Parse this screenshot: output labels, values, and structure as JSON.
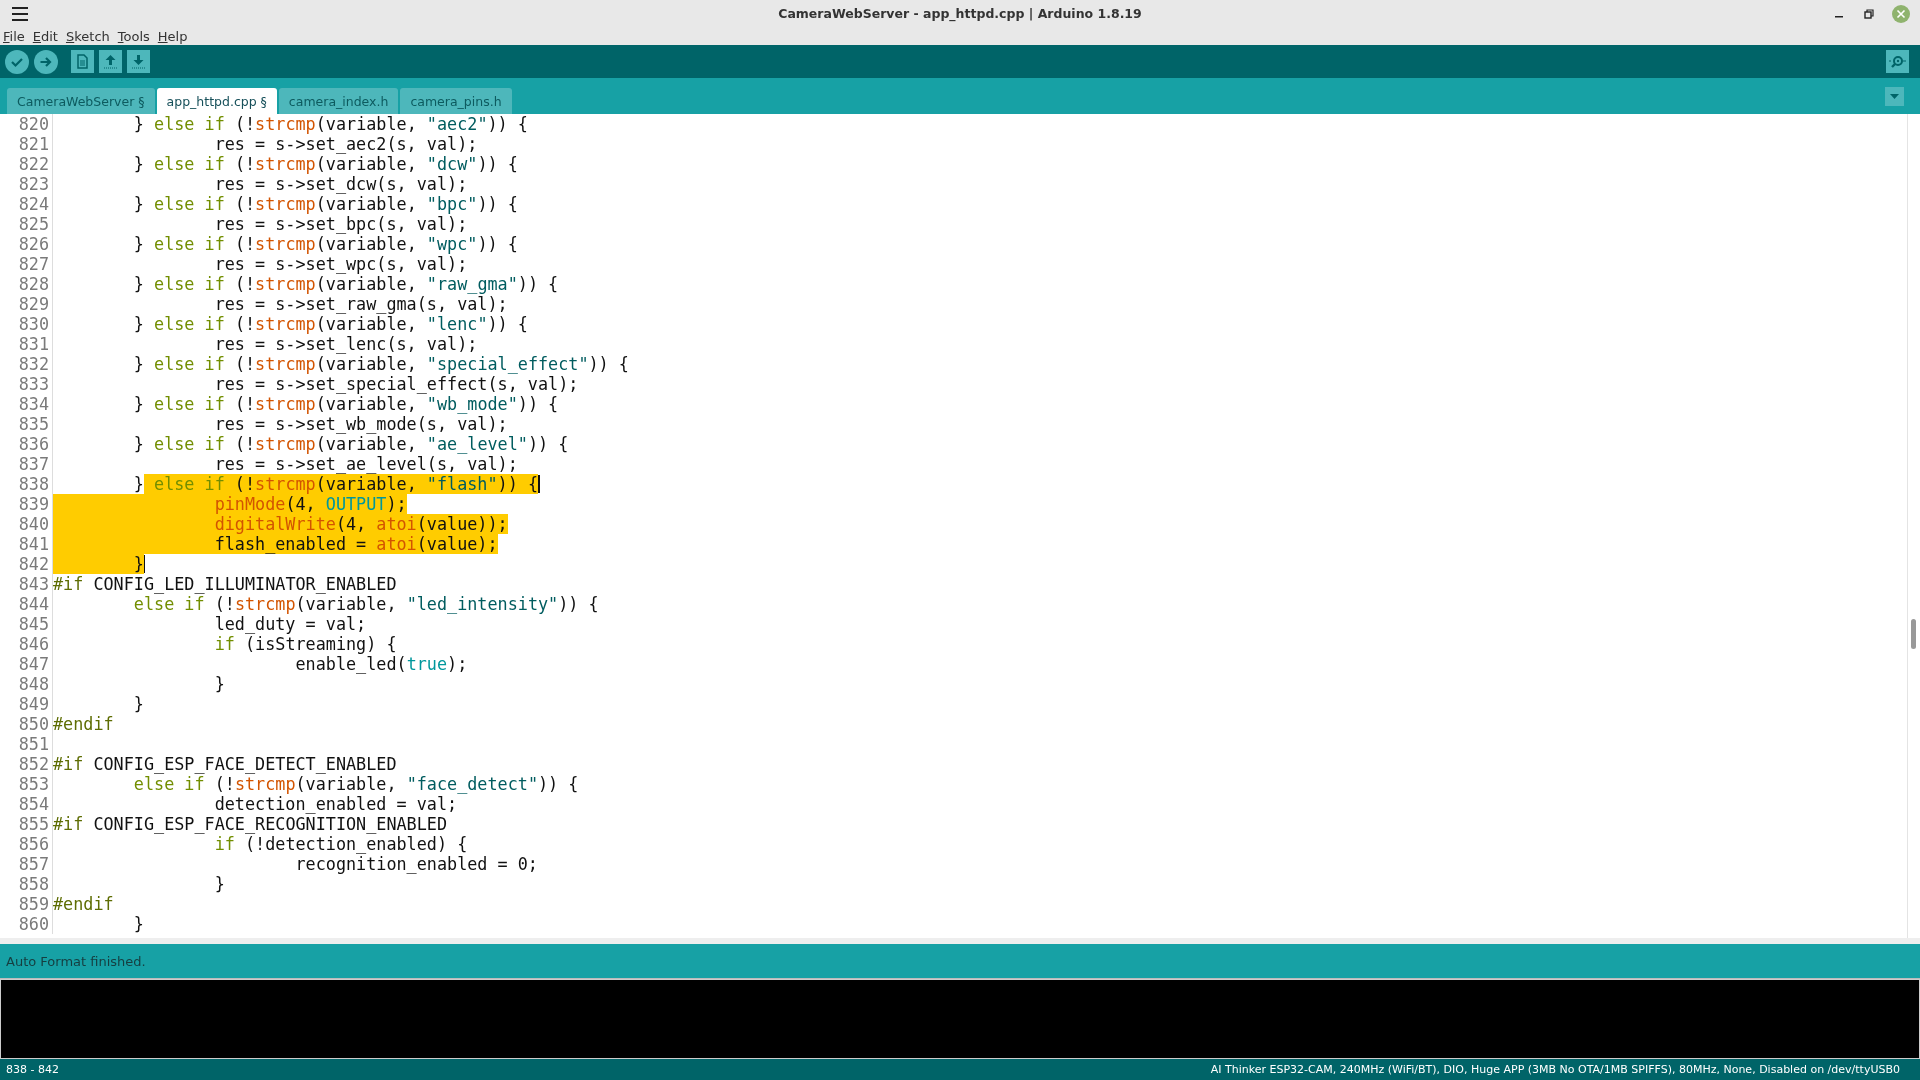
{
  "window": {
    "title": "CameraWebServer - app_httpd.cpp | Arduino 1.8.19"
  },
  "menu": [
    "File",
    "Edit",
    "Sketch",
    "Tools",
    "Help"
  ],
  "tabs": [
    {
      "label": "CameraWebServer §",
      "selected": false
    },
    {
      "label": "app_httpd.cpp §",
      "selected": true
    },
    {
      "label": "camera_index.h",
      "selected": false
    },
    {
      "label": "camera_pins.h",
      "selected": false
    }
  ],
  "editor": {
    "lines": [
      {
        "number": "820",
        "cursor": false,
        "tokens": [
          {
            "kind": "plain",
            "text": "        } "
          },
          {
            "kind": "keyword",
            "text": "else if"
          },
          {
            "kind": "plain",
            "text": " (!"
          },
          {
            "kind": "function",
            "text": "strcmp"
          },
          {
            "kind": "plain",
            "text": "(variable, "
          },
          {
            "kind": "string",
            "text": "\"aec2\""
          },
          {
            "kind": "plain",
            "text": ")) {"
          }
        ]
      },
      {
        "number": "821",
        "cursor": false,
        "tokens": [
          {
            "kind": "plain",
            "text": "                res = s->set_aec2(s, val);"
          }
        ]
      },
      {
        "number": "822",
        "cursor": false,
        "tokens": [
          {
            "kind": "plain",
            "text": "        } "
          },
          {
            "kind": "keyword",
            "text": "else if"
          },
          {
            "kind": "plain",
            "text": " (!"
          },
          {
            "kind": "function",
            "text": "strcmp"
          },
          {
            "kind": "plain",
            "text": "(variable, "
          },
          {
            "kind": "string",
            "text": "\"dcw\""
          },
          {
            "kind": "plain",
            "text": ")) {"
          }
        ]
      },
      {
        "number": "823",
        "cursor": false,
        "tokens": [
          {
            "kind": "plain",
            "text": "                res = s->set_dcw(s, val);"
          }
        ]
      },
      {
        "number": "824",
        "cursor": false,
        "tokens": [
          {
            "kind": "plain",
            "text": "        } "
          },
          {
            "kind": "keyword",
            "text": "else if"
          },
          {
            "kind": "plain",
            "text": " (!"
          },
          {
            "kind": "function",
            "text": "strcmp"
          },
          {
            "kind": "plain",
            "text": "(variable, "
          },
          {
            "kind": "string",
            "text": "\"bpc\""
          },
          {
            "kind": "plain",
            "text": ")) {"
          }
        ]
      },
      {
        "number": "825",
        "cursor": false,
        "tokens": [
          {
            "kind": "plain",
            "text": "                res = s->set_bpc(s, val);"
          }
        ]
      },
      {
        "number": "826",
        "cursor": false,
        "tokens": [
          {
            "kind": "plain",
            "text": "        } "
          },
          {
            "kind": "keyword",
            "text": "else if"
          },
          {
            "kind": "plain",
            "text": " (!"
          },
          {
            "kind": "function",
            "text": "strcmp"
          },
          {
            "kind": "plain",
            "text": "(variable, "
          },
          {
            "kind": "string",
            "text": "\"wpc\""
          },
          {
            "kind": "plain",
            "text": ")) {"
          }
        ]
      },
      {
        "number": "827",
        "cursor": false,
        "tokens": [
          {
            "kind": "plain",
            "text": "                res = s->set_wpc(s, val);"
          }
        ]
      },
      {
        "number": "828",
        "cursor": false,
        "tokens": [
          {
            "kind": "plain",
            "text": "        } "
          },
          {
            "kind": "keyword",
            "text": "else if"
          },
          {
            "kind": "plain",
            "text": " (!"
          },
          {
            "kind": "function",
            "text": "strcmp"
          },
          {
            "kind": "plain",
            "text": "(variable, "
          },
          {
            "kind": "string",
            "text": "\"raw_gma\""
          },
          {
            "kind": "plain",
            "text": ")) {"
          }
        ]
      },
      {
        "number": "829",
        "cursor": false,
        "tokens": [
          {
            "kind": "plain",
            "text": "                res = s->set_raw_gma(s, val);"
          }
        ]
      },
      {
        "number": "830",
        "cursor": false,
        "tokens": [
          {
            "kind": "plain",
            "text": "        } "
          },
          {
            "kind": "keyword",
            "text": "else if"
          },
          {
            "kind": "plain",
            "text": " (!"
          },
          {
            "kind": "function",
            "text": "strcmp"
          },
          {
            "kind": "plain",
            "text": "(variable, "
          },
          {
            "kind": "string",
            "text": "\"lenc\""
          },
          {
            "kind": "plain",
            "text": ")) {"
          }
        ]
      },
      {
        "number": "831",
        "cursor": false,
        "tokens": [
          {
            "kind": "plain",
            "text": "                res = s->set_lenc(s, val);"
          }
        ]
      },
      {
        "number": "832",
        "cursor": false,
        "tokens": [
          {
            "kind": "plain",
            "text": "        } "
          },
          {
            "kind": "keyword",
            "text": "else if"
          },
          {
            "kind": "plain",
            "text": " (!"
          },
          {
            "kind": "function",
            "text": "strcmp"
          },
          {
            "kind": "plain",
            "text": "(variable, "
          },
          {
            "kind": "string",
            "text": "\"special_effect\""
          },
          {
            "kind": "plain",
            "text": ")) {"
          }
        ]
      },
      {
        "number": "833",
        "cursor": false,
        "tokens": [
          {
            "kind": "plain",
            "text": "                res = s->set_special_effect(s, val);"
          }
        ]
      },
      {
        "number": "834",
        "cursor": false,
        "tokens": [
          {
            "kind": "plain",
            "text": "        } "
          },
          {
            "kind": "keyword",
            "text": "else if"
          },
          {
            "kind": "plain",
            "text": " (!"
          },
          {
            "kind": "function",
            "text": "strcmp"
          },
          {
            "kind": "plain",
            "text": "(variable, "
          },
          {
            "kind": "string",
            "text": "\"wb_mode\""
          },
          {
            "kind": "plain",
            "text": ")) {"
          }
        ]
      },
      {
        "number": "835",
        "cursor": false,
        "tokens": [
          {
            "kind": "plain",
            "text": "                res = s->set_wb_mode(s, val);"
          }
        ]
      },
      {
        "number": "836",
        "cursor": false,
        "tokens": [
          {
            "kind": "plain",
            "text": "        } "
          },
          {
            "kind": "keyword",
            "text": "else if"
          },
          {
            "kind": "plain",
            "text": " (!"
          },
          {
            "kind": "function",
            "text": "strcmp"
          },
          {
            "kind": "plain",
            "text": "(variable, "
          },
          {
            "kind": "string",
            "text": "\"ae_level\""
          },
          {
            "kind": "plain",
            "text": ")) {"
          }
        ]
      },
      {
        "number": "837",
        "cursor": false,
        "tokens": [
          {
            "kind": "plain",
            "text": "                res = s->set_ae_level(s, val);"
          }
        ]
      },
      {
        "number": "838",
        "cursor": true,
        "tokens": [
          {
            "kind": "plain",
            "text": "        }"
          }
        ],
        "selected_tokens": [
          {
            "kind": "keyword",
            "text": " else if"
          },
          {
            "kind": "plain",
            "text": " (!"
          },
          {
            "kind": "function",
            "text": "strcmp"
          },
          {
            "kind": "plain",
            "text": "(variable, "
          },
          {
            "kind": "string",
            "text": "\"flash\""
          },
          {
            "kind": "plain",
            "text": ")) {"
          }
        ]
      },
      {
        "number": "839",
        "cursor": false,
        "selected_tokens": [
          {
            "kind": "function",
            "text": "                pinMode"
          },
          {
            "kind": "plain",
            "text": "(4, "
          },
          {
            "kind": "constant",
            "text": "OUTPUT"
          },
          {
            "kind": "plain",
            "text": ");"
          }
        ]
      },
      {
        "number": "840",
        "cursor": false,
        "selected_tokens": [
          {
            "kind": "function",
            "text": "                digitalWrite"
          },
          {
            "kind": "plain",
            "text": "(4, "
          },
          {
            "kind": "function",
            "text": "atoi"
          },
          {
            "kind": "plain",
            "text": "(value));"
          }
        ]
      },
      {
        "number": "841",
        "cursor": false,
        "selected_tokens": [
          {
            "kind": "plain",
            "text": "                flash_enabled = "
          },
          {
            "kind": "function",
            "text": "atoi"
          },
          {
            "kind": "plain",
            "text": "(value);"
          }
        ]
      },
      {
        "number": "842",
        "cursor": true,
        "selected_tokens": [
          {
            "kind": "plain",
            "text": "        }"
          }
        ]
      },
      {
        "number": "843",
        "cursor": false,
        "tokens": [
          {
            "kind": "preprocessor",
            "text": "#if"
          },
          {
            "kind": "plain",
            "text": " CONFIG_LED_ILLUMINATOR_ENABLED"
          }
        ]
      },
      {
        "number": "844",
        "cursor": false,
        "tokens": [
          {
            "kind": "keyword",
            "text": "        else if"
          },
          {
            "kind": "plain",
            "text": " (!"
          },
          {
            "kind": "function",
            "text": "strcmp"
          },
          {
            "kind": "plain",
            "text": "(variable, "
          },
          {
            "kind": "string",
            "text": "\"led_intensity\""
          },
          {
            "kind": "plain",
            "text": ")) {"
          }
        ]
      },
      {
        "number": "845",
        "cursor": false,
        "tokens": [
          {
            "kind": "plain",
            "text": "                led_duty = val;"
          }
        ]
      },
      {
        "number": "846",
        "cursor": false,
        "tokens": [
          {
            "kind": "keyword",
            "text": "                if"
          },
          {
            "kind": "plain",
            "text": " (isStreaming) {"
          }
        ]
      },
      {
        "number": "847",
        "cursor": false,
        "tokens": [
          {
            "kind": "plain",
            "text": "                        enable_led("
          },
          {
            "kind": "constant",
            "text": "true"
          },
          {
            "kind": "plain",
            "text": ");"
          }
        ]
      },
      {
        "number": "848",
        "cursor": false,
        "tokens": [
          {
            "kind": "plain",
            "text": "                }"
          }
        ]
      },
      {
        "number": "849",
        "cursor": false,
        "tokens": [
          {
            "kind": "plain",
            "text": "        }"
          }
        ]
      },
      {
        "number": "850",
        "cursor": false,
        "tokens": [
          {
            "kind": "preprocessor",
            "text": "#endif"
          }
        ]
      },
      {
        "number": "851",
        "cursor": false
      },
      {
        "number": "852",
        "cursor": false,
        "tokens": [
          {
            "kind": "preprocessor",
            "text": "#if"
          },
          {
            "kind": "plain",
            "text": " CONFIG_ESP_FACE_DETECT_ENABLED"
          }
        ]
      },
      {
        "number": "853",
        "cursor": false,
        "tokens": [
          {
            "kind": "keyword",
            "text": "        else if"
          },
          {
            "kind": "plain",
            "text": " (!"
          },
          {
            "kind": "function",
            "text": "strcmp"
          },
          {
            "kind": "plain",
            "text": "(variable, "
          },
          {
            "kind": "string",
            "text": "\"face_detect\""
          },
          {
            "kind": "plain",
            "text": ")) {"
          }
        ]
      },
      {
        "number": "854",
        "cursor": false,
        "tokens": [
          {
            "kind": "plain",
            "text": "                detection_enabled = val;"
          }
        ]
      },
      {
        "number": "855",
        "cursor": false,
        "tokens": [
          {
            "kind": "preprocessor",
            "text": "#if"
          },
          {
            "kind": "plain",
            "text": " CONFIG_ESP_FACE_RECOGNITION_ENABLED"
          }
        ]
      },
      {
        "number": "856",
        "cursor": false,
        "tokens": [
          {
            "kind": "keyword",
            "text": "                if"
          },
          {
            "kind": "plain",
            "text": " (!detection_enabled) {"
          }
        ]
      },
      {
        "number": "857",
        "cursor": false,
        "tokens": [
          {
            "kind": "plain",
            "text": "                        recognition_enabled = 0;"
          }
        ]
      },
      {
        "number": "858",
        "cursor": false,
        "tokens": [
          {
            "kind": "plain",
            "text": "                }"
          }
        ]
      },
      {
        "number": "859",
        "cursor": false,
        "tokens": [
          {
            "kind": "preprocessor",
            "text": "#endif"
          }
        ]
      },
      {
        "number": "860",
        "cursor": false,
        "tokens": [
          {
            "kind": "plain",
            "text": "        }"
          }
        ]
      }
    ]
  },
  "message": "Auto Format finished.",
  "status_bar": {
    "selection": "838 - 842",
    "board": "AI Thinker ESP32-CAM, 240MHz (WiFi/BT), DIO, Huge APP (3MB No OTA/1MB SPIFFS), 80MHz, None, Disabled on /dev/ttyUSB0"
  }
}
